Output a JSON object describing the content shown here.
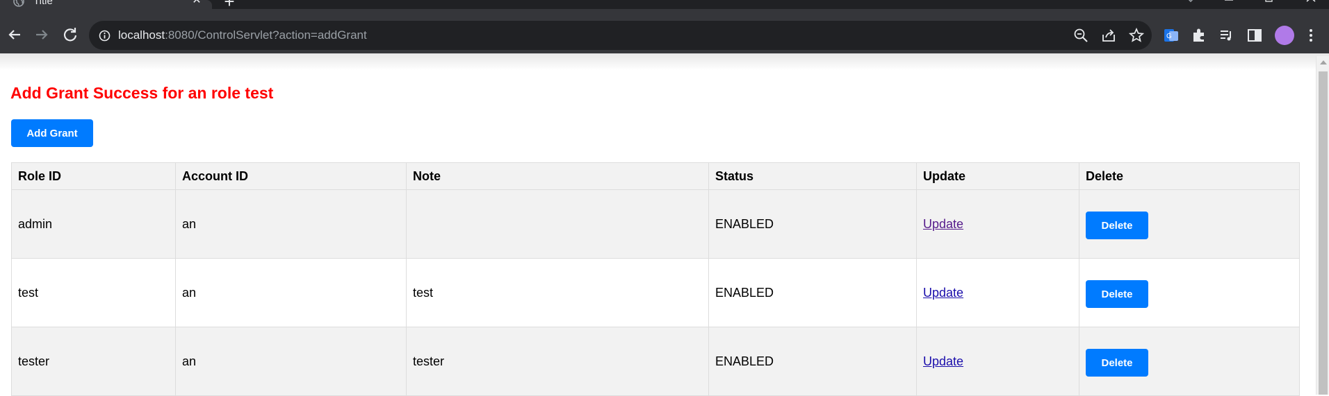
{
  "browser": {
    "tab_title": "Title",
    "url_host": "localhost",
    "url_rest": ":8080/ControlServlet?action=addGrant"
  },
  "page": {
    "message": "Add Grant Success for an role test",
    "add_button_label": "Add Grant",
    "table": {
      "headers": [
        "Role ID",
        "Account ID",
        "Note",
        "Status",
        "Update",
        "Delete"
      ],
      "rows": [
        {
          "role_id": "admin",
          "account_id": "an",
          "note": "",
          "status": "ENABLED",
          "update_label": "Update",
          "delete_label": "Delete"
        },
        {
          "role_id": "test",
          "account_id": "an",
          "note": "test",
          "status": "ENABLED",
          "update_label": "Update",
          "delete_label": "Delete"
        },
        {
          "role_id": "tester",
          "account_id": "an",
          "note": "tester",
          "status": "ENABLED",
          "update_label": "Update",
          "delete_label": "Delete"
        }
      ]
    }
  },
  "colors": {
    "message": "#ff0000",
    "primary_button": "#007bff",
    "header_row": "#f2f2f2"
  },
  "icons": {
    "tab_favicon": "globe-icon",
    "info": "info-icon",
    "zoom": "zoom-out-icon",
    "share": "share-icon",
    "bookmark": "star-icon",
    "extensions": "puzzle-icon",
    "media": "media-queue-icon",
    "side_panel": "side-panel-icon"
  }
}
